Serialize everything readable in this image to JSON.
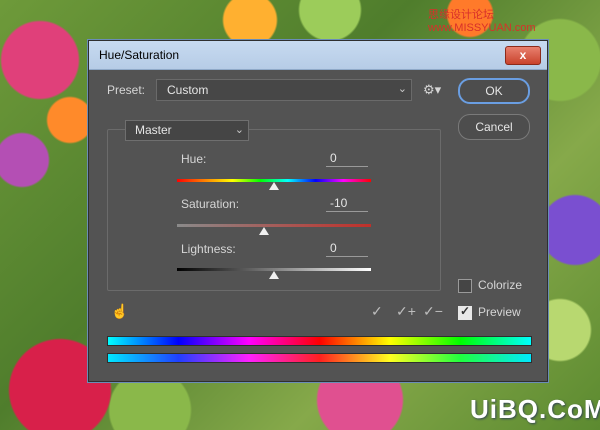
{
  "watermark_top": "思缘设计论坛 www.MISSYUAN.com",
  "watermark_bottom": "UiBQ.CoM",
  "dialog": {
    "title": "Hue/Saturation",
    "close_label": "x"
  },
  "preset": {
    "label": "Preset:",
    "value": "Custom"
  },
  "buttons": {
    "ok": "OK",
    "cancel": "Cancel"
  },
  "channel": {
    "value": "Master"
  },
  "sliders": {
    "hue": {
      "label": "Hue:",
      "value": "0",
      "min": -180,
      "max": 180
    },
    "saturation": {
      "label": "Saturation:",
      "value": "-10",
      "min": -100,
      "max": 100
    },
    "lightness": {
      "label": "Lightness:",
      "value": "0",
      "min": -100,
      "max": 100
    }
  },
  "options": {
    "colorize": {
      "label": "Colorize",
      "checked": false
    },
    "preview": {
      "label": "Preview",
      "checked": true
    }
  },
  "colors": {
    "dialog_bg": "#535353",
    "ok_focus": "#6a9ee2",
    "titlebar": "#c7daf0"
  },
  "icons": [
    "settings-gear-icon",
    "targeted-adjustment-hand-icon",
    "eyedropper-icon",
    "eyedropper-plus-icon",
    "eyedropper-minus-icon"
  ]
}
